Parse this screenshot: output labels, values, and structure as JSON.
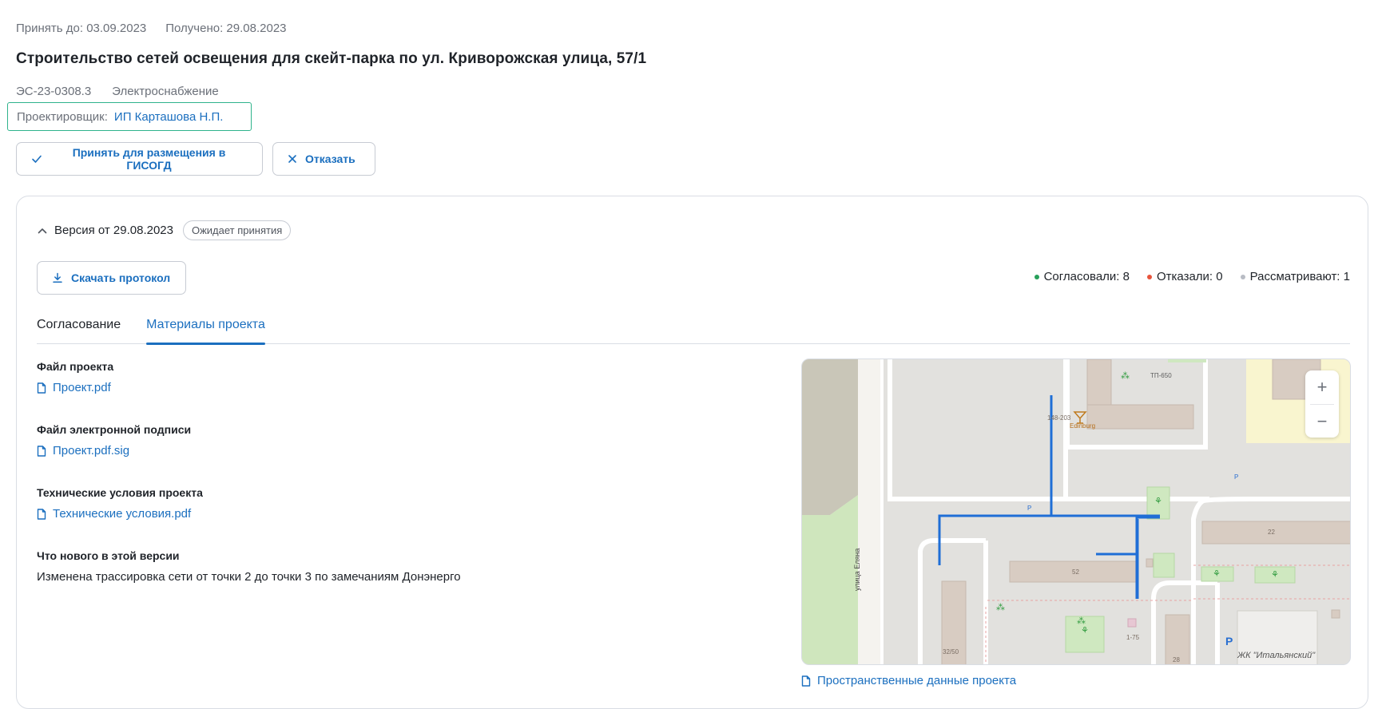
{
  "header": {
    "accept_until": "Принять до: 03.09.2023",
    "received": "Получено: 29.08.2023",
    "title": "Строительство сетей освещения для скейт-парка по ул. Криворожская улица, 57/1",
    "code": "ЭС-23-0308.3",
    "category": "Электроснабжение",
    "designer_label": "Проектировщик:",
    "designer_value": "ИП Карташова Н.П."
  },
  "actions": {
    "accept_label": "Принять для размещения в ГИСОГД",
    "reject_label": "Отказать"
  },
  "version": {
    "title": "Версия от 29.08.2023",
    "status": "Ожидает принятия",
    "download_label": "Скачать протокол"
  },
  "stats": [
    {
      "label": "Согласовали: 8",
      "color": "#27a05a"
    },
    {
      "label": "Отказали: 0",
      "color": "#e8543c"
    },
    {
      "label": "Рассматривают: 1",
      "color": "#b8bcc4"
    }
  ],
  "tabs": [
    {
      "label": "Согласование",
      "active": false
    },
    {
      "label": "Материалы проекта",
      "active": true
    }
  ],
  "materials": {
    "project_file_title": "Файл проекта",
    "project_file": "Проект.pdf",
    "signature_title": "Файл электронной подписи",
    "signature_file": "Проект.pdf.sig",
    "tech_title": "Технические условия проекта",
    "tech_file": "Технические условия.pdf",
    "whats_new_title": "Что нового в этой версии",
    "whats_new_text": "Изменена трассировка сети от точки 2 до точки 3 по замечаниям Донэнерго"
  },
  "map": {
    "street_label": "улица Еляна",
    "labels": {
      "tp": "ТП-650",
      "b148": "148-203",
      "edinburg": "Edinburg",
      "p1": "P",
      "p2": "P",
      "p3": "P",
      "b22": "22",
      "b52": "52",
      "b175": "1-75",
      "b3250": "32/50",
      "b28": "28",
      "zhk": "ЖК \"Итальянский\""
    },
    "zoom_in": "+",
    "zoom_out": "−",
    "spatial_link": "Пространственные данные проекта"
  }
}
